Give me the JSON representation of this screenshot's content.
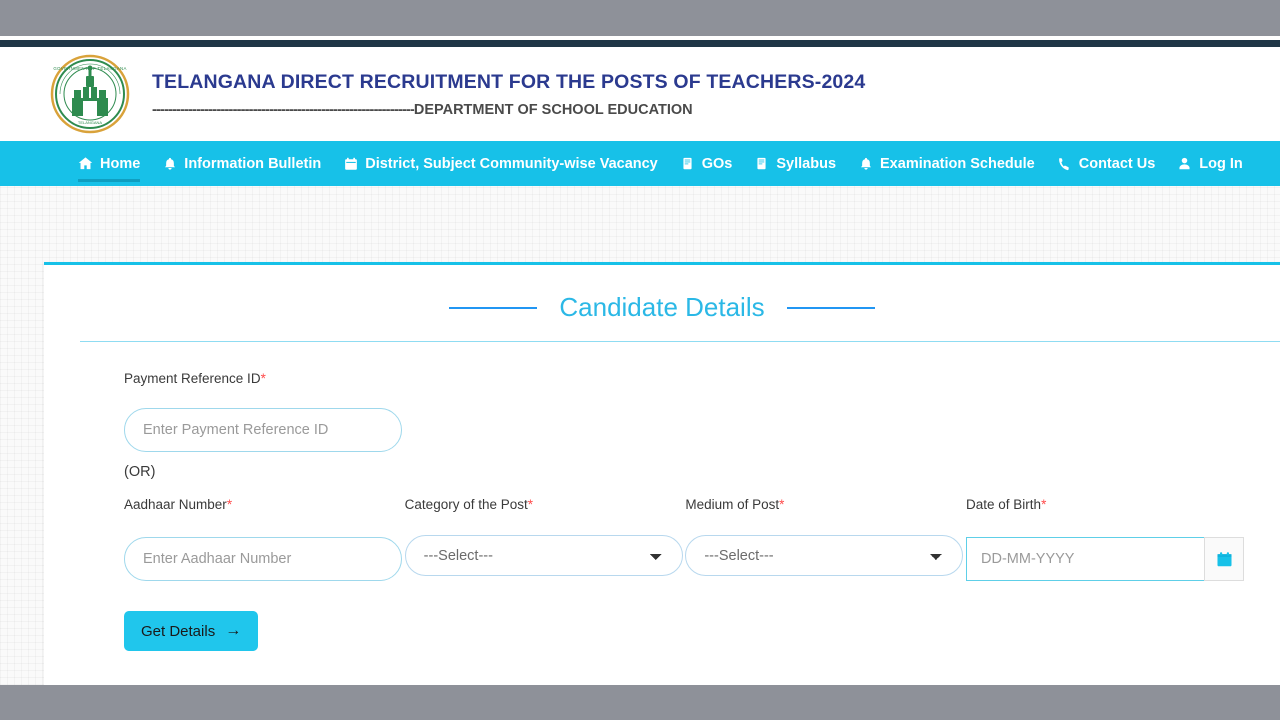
{
  "header": {
    "emblem_alt": "Government of Telangana emblem",
    "title": "TELANGANA DIRECT RECRUITMENT FOR THE POSTS OF TEACHERS-2024",
    "subtitle_dashes": "-----------------------------------------------------------------",
    "subtitle": "DEPARTMENT OF SCHOOL EDUCATION"
  },
  "nav": {
    "items": [
      {
        "label": "Home",
        "icon": "home-icon",
        "active": true
      },
      {
        "label": "Information Bulletin",
        "icon": "bell-icon",
        "active": false
      },
      {
        "label": "District, Subject Community-wise Vacancy",
        "icon": "calendar-icon",
        "active": false
      },
      {
        "label": "GOs",
        "icon": "book-icon",
        "active": false
      },
      {
        "label": "Syllabus",
        "icon": "book-icon",
        "active": false
      },
      {
        "label": "Examination Schedule",
        "icon": "bell-icon",
        "active": false
      },
      {
        "label": "Contact Us",
        "icon": "phone-icon",
        "active": false
      },
      {
        "label": "Log In",
        "icon": "user-icon",
        "active": false
      }
    ]
  },
  "card": {
    "title": "Candidate Details",
    "or_text": "(OR)",
    "fields": {
      "payment_reference": {
        "label": "Payment Reference ID",
        "required": "*",
        "placeholder": "Enter Payment Reference ID",
        "value": ""
      },
      "aadhaar": {
        "label": "Aadhaar Number",
        "required": "*",
        "placeholder": "Enter Aadhaar Number",
        "value": ""
      },
      "category_of_post": {
        "label": "Category of the Post",
        "required": "*",
        "selected": "---Select---",
        "options": [
          "---Select---"
        ]
      },
      "medium_of_post": {
        "label": "Medium of Post",
        "required": "*",
        "selected": "---Select---",
        "options": [
          "---Select---"
        ]
      },
      "date_of_birth": {
        "label": "Date of Birth",
        "required": "*",
        "placeholder": "DD-MM-YYYY",
        "value": "",
        "calendar_icon": "calendar-icon"
      }
    },
    "submit_label": "Get Details",
    "submit_arrow": "→"
  },
  "colors": {
    "accent_cyan": "#17c1e8",
    "nav_active_underline": "#0f9ec0",
    "title_cyan": "#2bb8e6",
    "title_rule_blue": "#2196f3",
    "header_navy": "#2b3a8f",
    "required_red": "#ff4b4b",
    "chrome_gray": "#8e9199",
    "navy_bar": "#1f3646",
    "button_cyan": "#20c6ec"
  }
}
